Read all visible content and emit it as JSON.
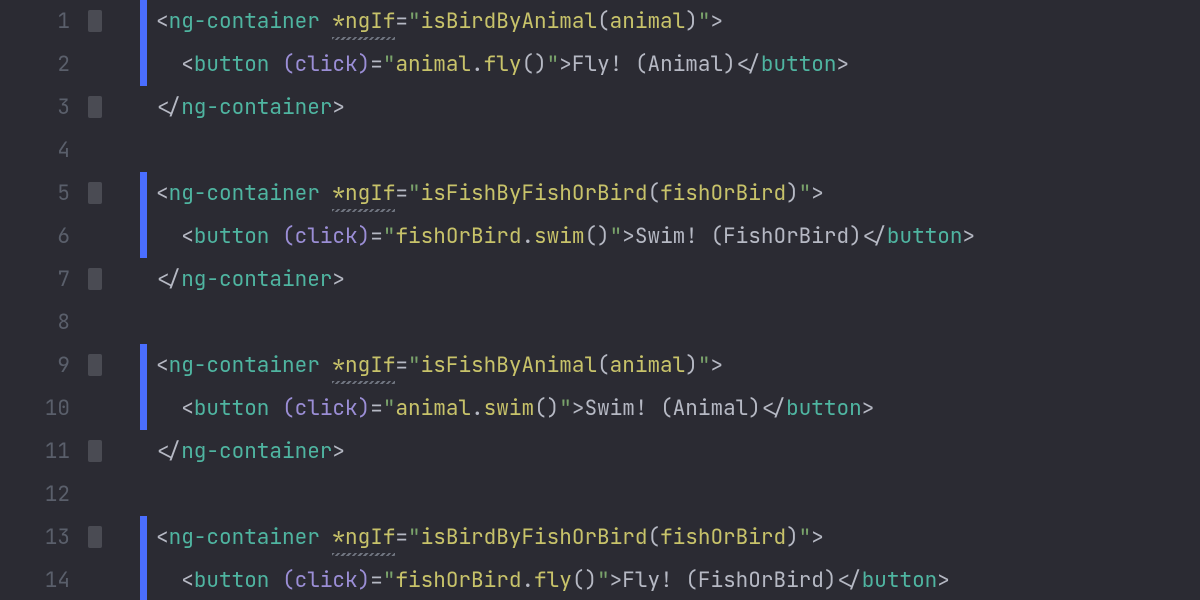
{
  "lines": [
    {
      "n": "1",
      "fold": true,
      "stripe": true,
      "tokens": [
        {
          "c": "punc",
          "t": "<"
        },
        {
          "c": "tag",
          "t": "ng-container "
        },
        {
          "c": "dir wavy",
          "t": "*ngIf"
        },
        {
          "c": "op",
          "t": "="
        },
        {
          "c": "str",
          "t": "\""
        },
        {
          "c": "fn",
          "t": "isBirdByAnimal"
        },
        {
          "c": "punc",
          "t": "("
        },
        {
          "c": "fn",
          "t": "animal"
        },
        {
          "c": "punc",
          "t": ")"
        },
        {
          "c": "str",
          "t": "\""
        },
        {
          "c": "punc",
          "t": ">"
        }
      ]
    },
    {
      "n": "2",
      "fold": false,
      "stripe": true,
      "tokens": [
        {
          "c": "punc",
          "t": "  <"
        },
        {
          "c": "tag",
          "t": "button "
        },
        {
          "c": "attr",
          "t": "(click)"
        },
        {
          "c": "op",
          "t": "="
        },
        {
          "c": "str",
          "t": "\""
        },
        {
          "c": "fn",
          "t": "animal"
        },
        {
          "c": "punc",
          "t": "."
        },
        {
          "c": "fn",
          "t": "fly"
        },
        {
          "c": "punc",
          "t": "()"
        },
        {
          "c": "str",
          "t": "\""
        },
        {
          "c": "punc",
          "t": ">"
        },
        {
          "c": "txt",
          "t": "Fly! (Animal)"
        },
        {
          "c": "punc",
          "t": "</"
        },
        {
          "c": "tag",
          "t": "button"
        },
        {
          "c": "punc",
          "t": ">"
        }
      ]
    },
    {
      "n": "3",
      "fold": true,
      "stripe": false,
      "tokens": [
        {
          "c": "punc",
          "t": "</"
        },
        {
          "c": "tag",
          "t": "ng-container"
        },
        {
          "c": "punc",
          "t": ">"
        }
      ]
    },
    {
      "n": "4",
      "fold": false,
      "stripe": false,
      "tokens": []
    },
    {
      "n": "5",
      "fold": true,
      "stripe": true,
      "tokens": [
        {
          "c": "punc",
          "t": "<"
        },
        {
          "c": "tag",
          "t": "ng-container "
        },
        {
          "c": "dir wavy",
          "t": "*ngIf"
        },
        {
          "c": "op",
          "t": "="
        },
        {
          "c": "str",
          "t": "\""
        },
        {
          "c": "fn",
          "t": "isFishByFishOrBird"
        },
        {
          "c": "punc",
          "t": "("
        },
        {
          "c": "fn",
          "t": "fishOrBird"
        },
        {
          "c": "punc",
          "t": ")"
        },
        {
          "c": "str",
          "t": "\""
        },
        {
          "c": "punc",
          "t": ">"
        }
      ]
    },
    {
      "n": "6",
      "fold": false,
      "stripe": true,
      "tokens": [
        {
          "c": "punc",
          "t": "  <"
        },
        {
          "c": "tag",
          "t": "button "
        },
        {
          "c": "attr",
          "t": "(click)"
        },
        {
          "c": "op",
          "t": "="
        },
        {
          "c": "str",
          "t": "\""
        },
        {
          "c": "fn",
          "t": "fishOrBird"
        },
        {
          "c": "punc",
          "t": "."
        },
        {
          "c": "fn",
          "t": "swim"
        },
        {
          "c": "punc",
          "t": "()"
        },
        {
          "c": "str",
          "t": "\""
        },
        {
          "c": "punc",
          "t": ">"
        },
        {
          "c": "txt",
          "t": "Swim! (FishOrBird)"
        },
        {
          "c": "punc",
          "t": "</"
        },
        {
          "c": "tag",
          "t": "button"
        },
        {
          "c": "punc",
          "t": ">"
        }
      ]
    },
    {
      "n": "7",
      "fold": true,
      "stripe": false,
      "tokens": [
        {
          "c": "punc",
          "t": "</"
        },
        {
          "c": "tag",
          "t": "ng-container"
        },
        {
          "c": "punc",
          "t": ">"
        }
      ]
    },
    {
      "n": "8",
      "fold": false,
      "stripe": false,
      "tokens": []
    },
    {
      "n": "9",
      "fold": true,
      "stripe": true,
      "tokens": [
        {
          "c": "punc",
          "t": "<"
        },
        {
          "c": "tag",
          "t": "ng-container "
        },
        {
          "c": "dir wavy",
          "t": "*ngIf"
        },
        {
          "c": "op",
          "t": "="
        },
        {
          "c": "str",
          "t": "\""
        },
        {
          "c": "fn",
          "t": "isFishByAnimal"
        },
        {
          "c": "punc",
          "t": "("
        },
        {
          "c": "fn",
          "t": "animal"
        },
        {
          "c": "punc",
          "t": ")"
        },
        {
          "c": "str",
          "t": "\""
        },
        {
          "c": "punc",
          "t": ">"
        }
      ]
    },
    {
      "n": "10",
      "fold": false,
      "stripe": true,
      "tokens": [
        {
          "c": "punc",
          "t": "  <"
        },
        {
          "c": "tag",
          "t": "button "
        },
        {
          "c": "attr",
          "t": "(click)"
        },
        {
          "c": "op",
          "t": "="
        },
        {
          "c": "str",
          "t": "\""
        },
        {
          "c": "fn",
          "t": "animal"
        },
        {
          "c": "punc",
          "t": "."
        },
        {
          "c": "fn",
          "t": "swim"
        },
        {
          "c": "punc",
          "t": "()"
        },
        {
          "c": "str",
          "t": "\""
        },
        {
          "c": "punc",
          "t": ">"
        },
        {
          "c": "txt",
          "t": "Swim! (Animal)"
        },
        {
          "c": "punc",
          "t": "</"
        },
        {
          "c": "tag",
          "t": "button"
        },
        {
          "c": "punc",
          "t": ">"
        }
      ]
    },
    {
      "n": "11",
      "fold": true,
      "stripe": false,
      "tokens": [
        {
          "c": "punc",
          "t": "</"
        },
        {
          "c": "tag",
          "t": "ng-container"
        },
        {
          "c": "punc",
          "t": ">"
        }
      ]
    },
    {
      "n": "12",
      "fold": false,
      "stripe": false,
      "tokens": []
    },
    {
      "n": "13",
      "fold": true,
      "stripe": true,
      "tokens": [
        {
          "c": "punc",
          "t": "<"
        },
        {
          "c": "tag",
          "t": "ng-container "
        },
        {
          "c": "dir wavy",
          "t": "*ngIf"
        },
        {
          "c": "op",
          "t": "="
        },
        {
          "c": "str",
          "t": "\""
        },
        {
          "c": "fn",
          "t": "isBirdByFishOrBird"
        },
        {
          "c": "punc",
          "t": "("
        },
        {
          "c": "fn",
          "t": "fishOrBird"
        },
        {
          "c": "punc",
          "t": ")"
        },
        {
          "c": "str",
          "t": "\""
        },
        {
          "c": "punc",
          "t": ">"
        }
      ]
    },
    {
      "n": "14",
      "fold": false,
      "stripe": true,
      "tokens": [
        {
          "c": "punc",
          "t": "  <"
        },
        {
          "c": "tag",
          "t": "button "
        },
        {
          "c": "attr",
          "t": "(click)"
        },
        {
          "c": "op",
          "t": "="
        },
        {
          "c": "str",
          "t": "\""
        },
        {
          "c": "fn",
          "t": "fishOrBird"
        },
        {
          "c": "punc",
          "t": "."
        },
        {
          "c": "fn",
          "t": "fly"
        },
        {
          "c": "punc",
          "t": "()"
        },
        {
          "c": "str",
          "t": "\""
        },
        {
          "c": "punc",
          "t": ">"
        },
        {
          "c": "txt",
          "t": "Fly! (FishOrBird)"
        },
        {
          "c": "punc",
          "t": "</"
        },
        {
          "c": "tag",
          "t": "button"
        },
        {
          "c": "punc",
          "t": ">"
        }
      ]
    }
  ]
}
